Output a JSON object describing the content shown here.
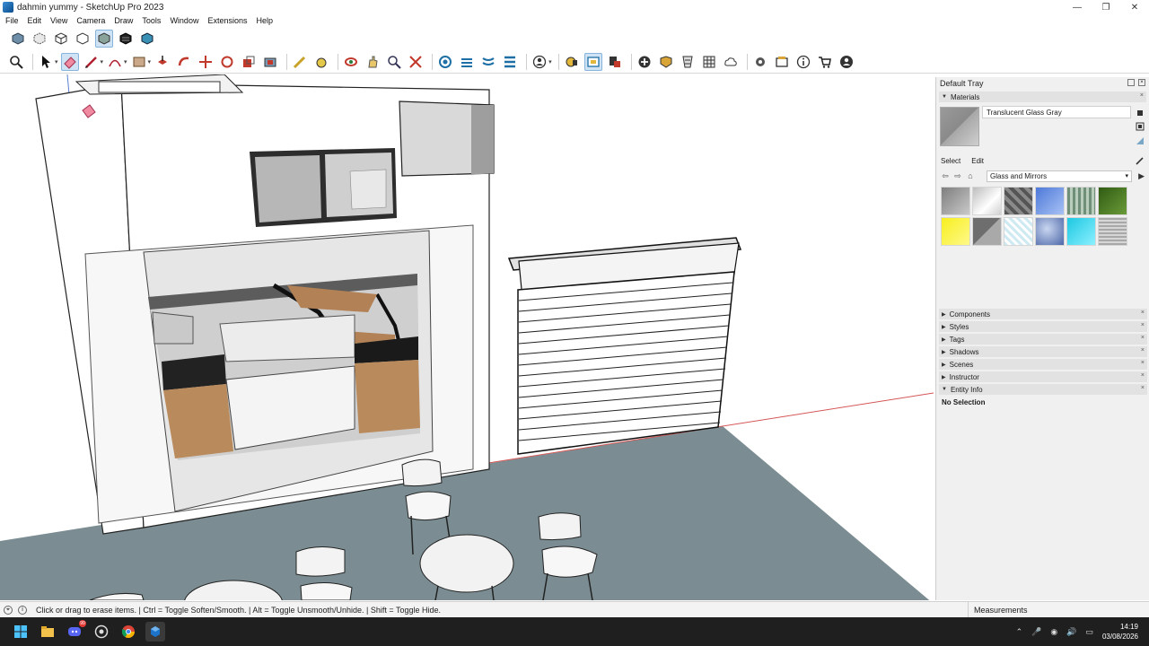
{
  "window": {
    "title": "dahmin yummy - SketchUp Pro 2023",
    "controls": [
      "—",
      "❐",
      "✕"
    ]
  },
  "menu": [
    "File",
    "Edit",
    "View",
    "Camera",
    "Draw",
    "Tools",
    "Window",
    "Extensions",
    "Help"
  ],
  "toolbar_top": [
    "xray-icon",
    "back-edges-icon",
    "wireframe-icon",
    "hidden-line-icon",
    "shaded-icon",
    "shaded-texture-icon",
    "monochrome-icon"
  ],
  "toolbar_main": [
    "zoom-icon",
    "select-icon",
    "eraser-icon",
    "pencil-icon",
    "arc-icon",
    "rectangle-icon",
    "pushpull-icon",
    "followme-icon",
    "move-icon",
    "rotate-icon",
    "scale-icon",
    "offset-icon",
    "tape-icon",
    "paint-icon",
    "orbit-icon",
    "pan-icon",
    "zoom-window-icon",
    "zoom-extents-icon",
    "section-icon",
    "section-display-icon",
    "section-fill-icon",
    "style-icon",
    "warehouse-icon",
    "extension-icon",
    "layout-icon",
    "add-location-icon",
    "geo-icon",
    "match-photo-icon",
    "sandbox-icon",
    "cloud-icon",
    "settings-icon",
    "outliner-icon",
    "info-icon",
    "cart-icon",
    "account-icon"
  ],
  "tray": {
    "title": "Default Tray",
    "materials_label": "Materials",
    "material_name": "Translucent Glass Gray",
    "tab_select": "Select",
    "tab_edit": "Edit",
    "library": "Glass and Mirrors",
    "swatches": [
      "#9a9a9a",
      "#e4e4e4",
      "#5c5c5c",
      "#6f95e6",
      "#8aa38e",
      "#3f6a1d",
      "#f5ef2c",
      "#8d8d8d",
      "#d3ecf2",
      "#6c84bd",
      "#3fd7ee",
      "#bdbdbd"
    ],
    "panels": [
      "Components",
      "Styles",
      "Tags",
      "Shadows",
      "Scenes",
      "Instructor",
      "Entity Info"
    ],
    "entity_info_text": "No Selection"
  },
  "status": {
    "hint": "Click or drag to erase items. | Ctrl = Toggle Soften/Smooth. | Alt = Toggle Unsmooth/Unhide. | Shift = Toggle Hide.",
    "measurements_label": "Measurements"
  },
  "taskbar": {
    "apps": [
      "windows-start-icon",
      "file-explorer-icon",
      "discord-icon",
      "github-icon",
      "chrome-icon",
      "sketchup-icon"
    ],
    "discord_badge": "99",
    "time": "14:19",
    "date": "03/08/2026"
  }
}
